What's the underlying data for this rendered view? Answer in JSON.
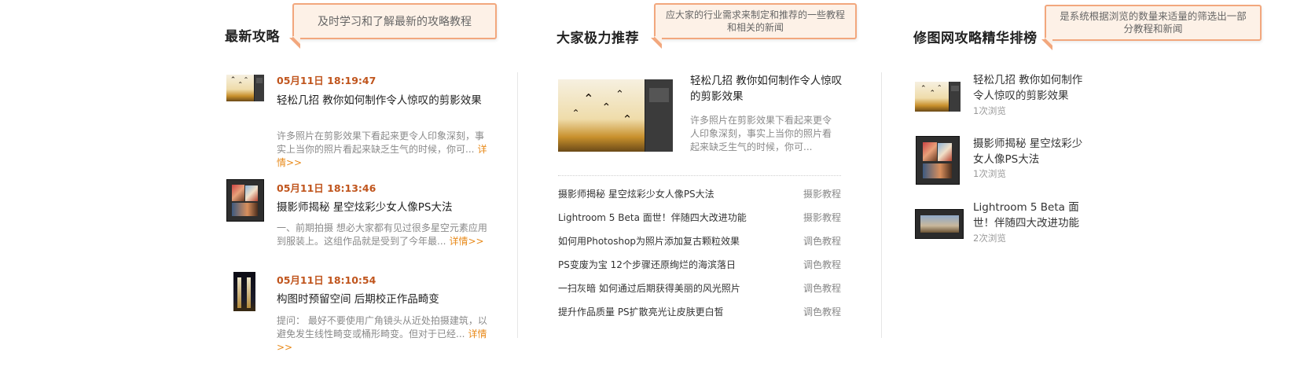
{
  "sections": [
    {
      "title": "最新攻略",
      "tip": "及时学习和了解最新的攻略教程"
    },
    {
      "title": "大家极力推荐",
      "tip": "应大家的行业需求来制定和推荐的一些教程和相关的新闻"
    },
    {
      "title": "修图网攻略精华排榜",
      "tip": "是系统根据浏览的数量来适量的筛选出一部分教程和新闻"
    }
  ],
  "latest": {
    "more_label": "详情>>",
    "items": [
      {
        "date": "05月11日 18:19:47",
        "title": "轻松几招 教你如何制作令人惊叹的剪影效果",
        "desc": "许多照片在剪影效果下看起来更令人印象深刻，事实上当你的照片看起来缺乏生气的时候，你可..."
      },
      {
        "date": "05月11日 18:13:46",
        "title": "摄影师揭秘 星空炫彩少女人像PS大法",
        "desc": "一、前期拍摄 想必大家都有见过很多星空元素应用到服装上。这组作品就是受到了今年最..."
      },
      {
        "date": "05月11日 18:10:54",
        "title": "构图时预留空间 后期校正作品畸变",
        "desc": "提问： 最好不要使用广角镜头从近处拍摄建筑，以避免发生线性畸变或桶形畸变。但对于已经..."
      }
    ]
  },
  "recommend": {
    "feature": {
      "title": "轻松几招 教你如何制作令人惊叹的剪影效果",
      "desc": "许多照片在剪影效果下看起来更令人印象深刻，事实上当你的照片看起来缺乏生气的时候，你可..."
    },
    "list": [
      {
        "title": "摄影师揭秘 星空炫彩少女人像PS大法",
        "category": "摄影教程"
      },
      {
        "title": "Lightroom 5 Beta 面世！伴随四大改进功能",
        "category": "摄影教程"
      },
      {
        "title": "如何用Photoshop为照片添加复古颗粒效果",
        "category": "调色教程"
      },
      {
        "title": "PS变废为宝 12个步骤还原绚烂的海滨落日",
        "category": "调色教程"
      },
      {
        "title": "一扫灰暗 如何通过后期获得美丽的风光照片",
        "category": "调色教程"
      },
      {
        "title": "提升作品质量 PS扩散亮光让皮肤更白皙",
        "category": "调色教程"
      }
    ]
  },
  "ranking": {
    "items": [
      {
        "title": "轻松几招 教你如何制作令人惊叹的剪影效果",
        "views": "1次浏览"
      },
      {
        "title": "摄影师揭秘 星空炫彩少女人像PS大法",
        "views": "1次浏览"
      },
      {
        "title": "Lightroom 5 Beta 面世！伴随四大改进功能",
        "views": "2次浏览"
      }
    ]
  },
  "colors": {
    "accent": "#c0551d",
    "link": "#e88a1a",
    "bubble_border": "#f2a77d",
    "bubble_bg": "#fdf1e7"
  }
}
